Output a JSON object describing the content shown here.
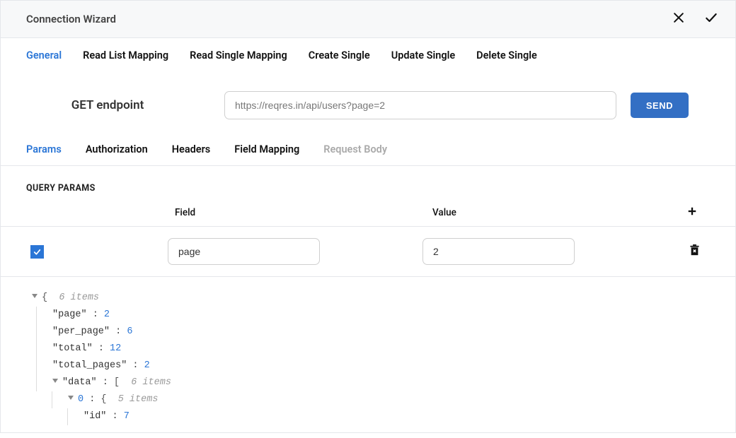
{
  "header": {
    "title": "Connection Wizard"
  },
  "tabs": [
    {
      "label": "General",
      "active": true
    },
    {
      "label": "Read List Mapping",
      "active": false
    },
    {
      "label": "Read Single Mapping",
      "active": false
    },
    {
      "label": "Create Single",
      "active": false
    },
    {
      "label": "Update Single",
      "active": false
    },
    {
      "label": "Delete Single",
      "active": false
    }
  ],
  "endpoint": {
    "label": "GET endpoint",
    "value": "https://reqres.in/api/users?page=2",
    "send_label": "SEND"
  },
  "subtabs": [
    {
      "label": "Params",
      "active": true,
      "disabled": false
    },
    {
      "label": "Authorization",
      "active": false,
      "disabled": false
    },
    {
      "label": "Headers",
      "active": false,
      "disabled": false
    },
    {
      "label": "Field Mapping",
      "active": false,
      "disabled": false
    },
    {
      "label": "Request Body",
      "active": false,
      "disabled": true
    }
  ],
  "query_params": {
    "section_title": "QUERY PARAMS",
    "columns": {
      "field": "Field",
      "value": "Value"
    },
    "rows": [
      {
        "checked": true,
        "field": "page",
        "value": "2"
      }
    ]
  },
  "response": {
    "root_count": "6 items",
    "entries": [
      {
        "key": "\"page\"",
        "value": "2",
        "type": "num"
      },
      {
        "key": "\"per_page\"",
        "value": "6",
        "type": "num"
      },
      {
        "key": "\"total\"",
        "value": "12",
        "type": "num"
      },
      {
        "key": "\"total_pages\"",
        "value": "2",
        "type": "num"
      }
    ],
    "data_key": "\"data\"",
    "data_count": "6 items",
    "data_first_index": "0",
    "data_first_count": "5 items",
    "data_first_entry": {
      "key": "\"id\"",
      "value": "7"
    }
  }
}
